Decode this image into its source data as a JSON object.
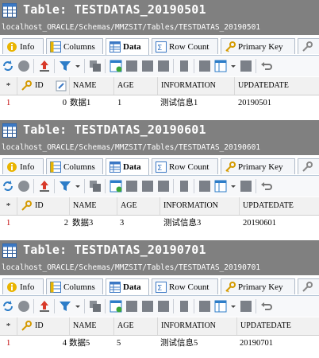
{
  "panels": [
    {
      "title": "Table: TESTDATAS_20190501",
      "path": "localhost_ORACLE/Schemas/MMZSIT/Tables/TESTDATAS_20190501",
      "tabs": [
        "Info",
        "Columns",
        "Data",
        "Row Count",
        "Primary Key"
      ],
      "active_tab": "Data",
      "grid": {
        "marker": "*",
        "columns": [
          "ID",
          "NAME",
          "AGE",
          "INFORMATION",
          "UPDATEDATE"
        ],
        "rows": [
          {
            "rownum": "1",
            "id": "0",
            "name": "数据1",
            "age": "1",
            "information": "测试信息1",
            "updatedate": "20190501"
          }
        ]
      }
    },
    {
      "title": "Table: TESTDATAS_20190601",
      "path": "localhost_ORACLE/Schemas/MMZSIT/Tables/TESTDATAS_20190601",
      "tabs": [
        "Info",
        "Columns",
        "Data",
        "Row Count",
        "Primary Key"
      ],
      "active_tab": "Data",
      "grid": {
        "marker": "*",
        "columns": [
          "ID",
          "NAME",
          "AGE",
          "INFORMATION",
          "UPDATEDATE"
        ],
        "rows": [
          {
            "rownum": "1",
            "id": "2",
            "name": "数据3",
            "age": "3",
            "information": "测试信息3",
            "updatedate": "20190601"
          }
        ]
      }
    },
    {
      "title": "Table: TESTDATAS_20190701",
      "path": "localhost_ORACLE/Schemas/MMZSIT/Tables/TESTDATAS_20190701",
      "tabs": [
        "Info",
        "Columns",
        "Data",
        "Row Count",
        "Primary Key"
      ],
      "active_tab": "Data",
      "grid": {
        "marker": "*",
        "columns": [
          "ID",
          "NAME",
          "AGE",
          "INFORMATION",
          "UPDATEDATE"
        ],
        "rows": [
          {
            "rownum": "1",
            "id": "4",
            "name": "数据5",
            "age": "5",
            "information": "测试信息5",
            "updatedate": "20190701"
          }
        ]
      }
    }
  ],
  "toolbar_icons": [
    "refresh-icon",
    "stop-icon",
    "export-icon",
    "filter-icon",
    "copy-icon",
    "table-add-icon",
    "save-icon",
    "delete-icon",
    "insert-icon",
    "edit-icon",
    "grid-view-icon",
    "columns-icon",
    "form-view-icon",
    "undo-icon"
  ],
  "colors": {
    "titlebar": "#808080",
    "accent_blue": "#3b78c4",
    "rownum_red": "#c00000"
  }
}
